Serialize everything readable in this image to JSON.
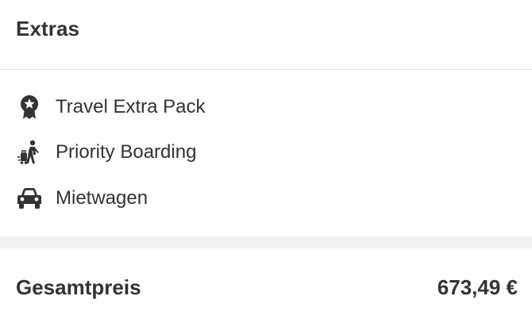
{
  "extras": {
    "title": "Extras",
    "items": [
      {
        "icon": "award-badge-icon",
        "label": "Travel Extra Pack"
      },
      {
        "icon": "priority-boarding-icon",
        "label": "Priority Boarding"
      },
      {
        "icon": "car-icon",
        "label": "Mietwagen"
      }
    ]
  },
  "total": {
    "label": "Gesamtpreis",
    "value": "673,49 €"
  },
  "colors": {
    "text": "#333333",
    "divider_band": "#f1f1f1",
    "border": "#e6e6e6"
  }
}
